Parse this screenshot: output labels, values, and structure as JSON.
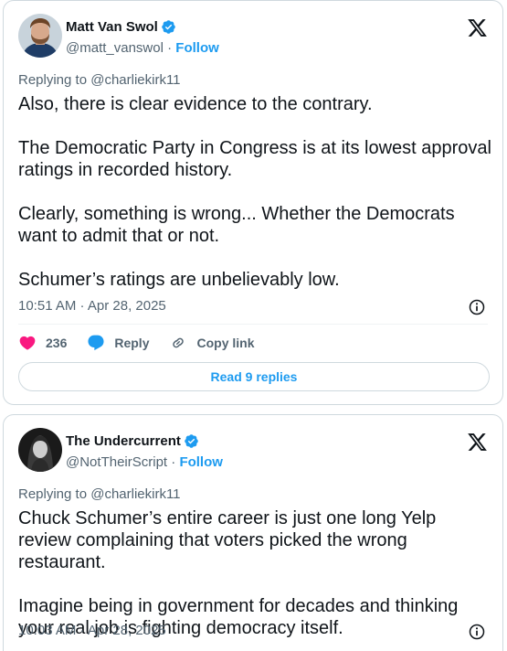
{
  "tweets": [
    {
      "author_name": "Matt Van Swol",
      "handle": "@matt_vanswol",
      "separator": "·",
      "follow_label": "Follow",
      "replying_to": "Replying to @charliekirk11",
      "text": "Also, there is clear evidence to the contrary.\n\nThe Democratic Party in Congress is at its lowest approval ratings in recorded history.\n\nClearly, something is wrong... Whether the Democrats want to admit that or not.\n\nSchumer’s ratings are unbelievably low.",
      "timestamp": "10:51 AM · Apr 28, 2025",
      "likes": "236",
      "reply_label": "Reply",
      "copy_link_label": "Copy link",
      "read_replies_label": "Read 9 replies"
    },
    {
      "author_name": "The Undercurrent",
      "handle": "@NotTheirScript",
      "separator": "·",
      "follow_label": "Follow",
      "replying_to": "Replying to @charliekirk11",
      "text": "Chuck Schumer’s entire career is just one long Yelp review complaining that voters picked the wrong restaurant.\n\nImagine being in government for decades and thinking your real job is fighting democracy itself.",
      "timestamp": "10:03 AM · Apr 28, 2025"
    }
  ],
  "colors": {
    "accent": "#1d9bf0",
    "like": "#f91880",
    "muted": "#536471",
    "text": "#0f1419"
  },
  "icons": [
    "verified-badge-icon",
    "x-logo-icon",
    "info-icon",
    "heart-icon",
    "reply-bubble-icon",
    "link-icon"
  ]
}
